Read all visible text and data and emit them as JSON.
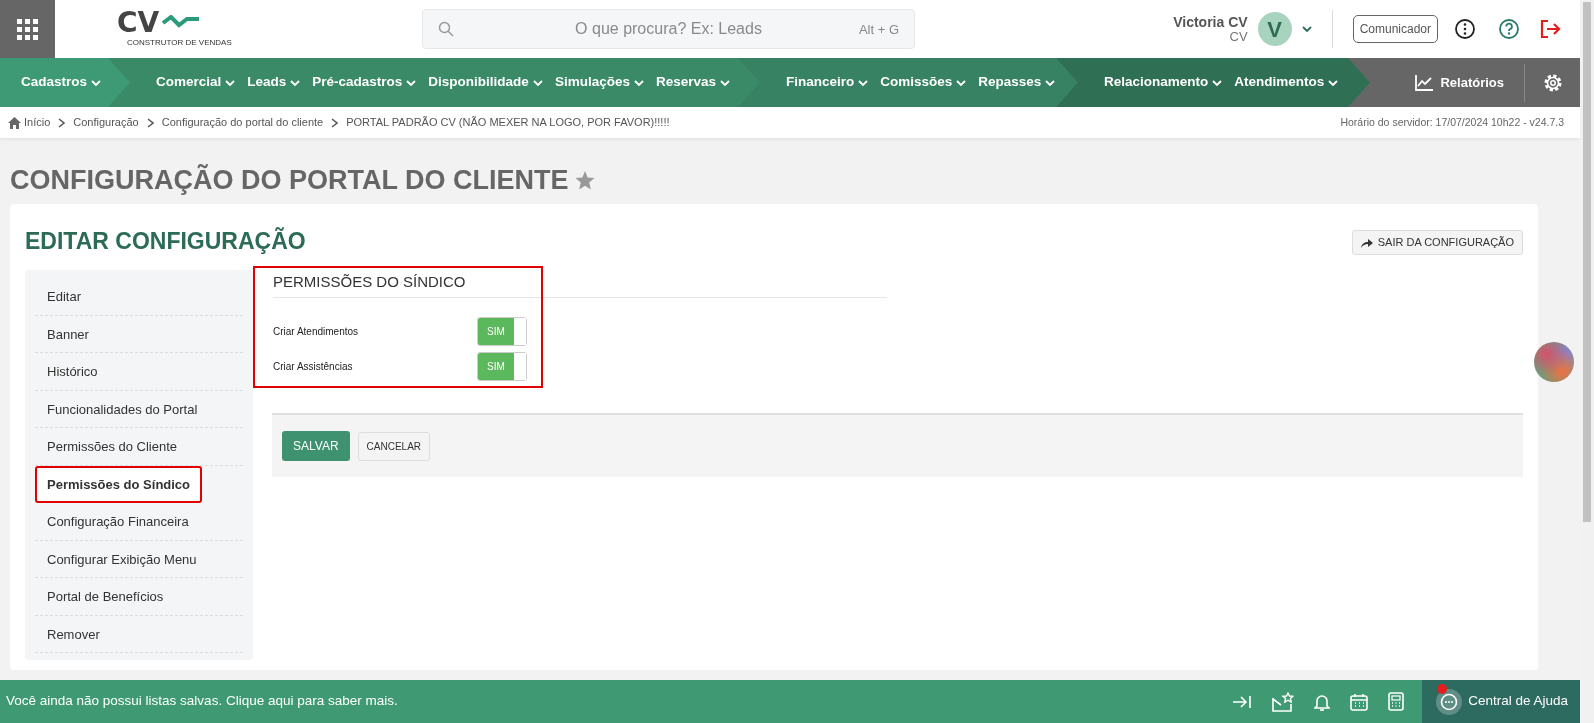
{
  "header": {
    "logo_text": "CV",
    "logo_tagline": "CONSTRUTOR DE VENDAS",
    "search_placeholder": "O que procura? Ex: Leads",
    "search_shortcut": "Alt + G",
    "user_name": "Victoria CV",
    "user_role": "CV",
    "avatar_letter": "V",
    "communicator": "Comunicador"
  },
  "nav": {
    "groups": [
      {
        "items": [
          "Cadastros"
        ]
      },
      {
        "items": [
          "Comercial",
          "Leads",
          "Pré-cadastros",
          "Disponibilidade",
          "Simulações",
          "Reservas"
        ]
      },
      {
        "items": [
          "Financeiro",
          "Comissões",
          "Repasses"
        ]
      },
      {
        "items": [
          "Relacionamento",
          "Atendimentos"
        ]
      }
    ],
    "reports": "Relatórios"
  },
  "breadcrumb": {
    "items": [
      "Início",
      "Configuração",
      "Configuração do portal do cliente",
      "PORTAL PADRÃO CV (NÃO MEXER NA LOGO, POR FAVOR)!!!!!"
    ],
    "server_time": "Horário do servidor: 17/07/2024 10h22 - v24.7.3"
  },
  "page_title": "CONFIGURAÇÃO DO PORTAL DO CLIENTE",
  "card": {
    "title": "EDITAR CONFIGURAÇÃO",
    "exit_button": "SAIR DA CONFIGURAÇÃO",
    "menu": [
      {
        "label": "Editar",
        "selected": false,
        "outlined": false
      },
      {
        "label": "Banner",
        "selected": false,
        "outlined": false
      },
      {
        "label": "Histórico",
        "selected": false,
        "outlined": false
      },
      {
        "label": "Funcionalidades do Portal",
        "selected": false,
        "outlined": false
      },
      {
        "label": "Permissões do Cliente",
        "selected": false,
        "outlined": false
      },
      {
        "label": "Permissões do Síndico",
        "selected": true,
        "outlined": true
      },
      {
        "label": "Configuração Financeira",
        "selected": false,
        "outlined": false
      },
      {
        "label": "Configurar Exibição Menu",
        "selected": false,
        "outlined": false
      },
      {
        "label": "Portal de Benefícios",
        "selected": false,
        "outlined": false
      },
      {
        "label": "Remover",
        "selected": false,
        "outlined": false
      }
    ],
    "panel": {
      "title": "PERMISSÕES DO SÍNDICO",
      "outlined": true,
      "rows": [
        {
          "label": "Criar Atendimentos",
          "on": true,
          "toggle_text": "SIM"
        },
        {
          "label": "Criar Assistências",
          "on": true,
          "toggle_text": "SIM"
        }
      ]
    },
    "save": "SALVAR",
    "cancel": "CANCELAR"
  },
  "footer": {
    "message": "Você ainda não possui listas salvas. Clique aqui para saber mais.",
    "help": "Central de Ajuda",
    "help_notification": true
  }
}
